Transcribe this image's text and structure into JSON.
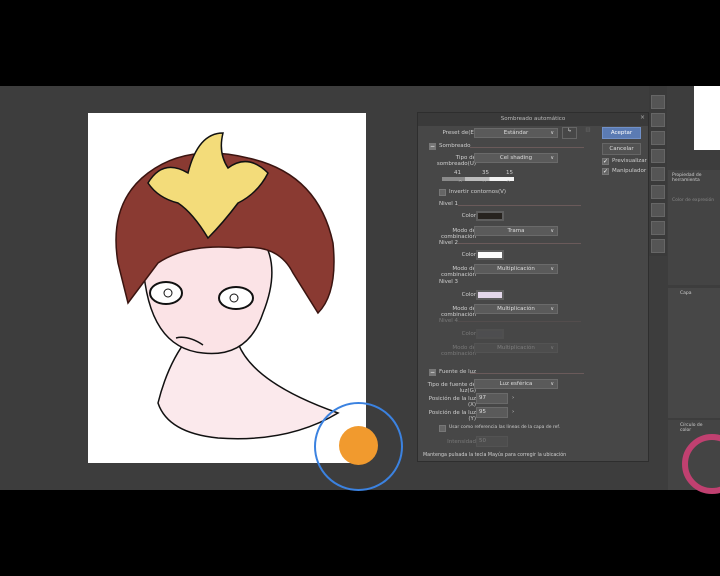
{
  "dialog": {
    "title": "Sombreado automático",
    "close": "×",
    "preset_label": "Preset de(E)",
    "preset_value": "Estándar",
    "ok": "Aceptar",
    "cancel": "Cancelar",
    "preview": "Previsualizar",
    "manipulator": "Manipulador",
    "shading_section": "Sombreado",
    "shading_type_label": "Tipo de sombreado(U)",
    "shading_type_value": "Cel shading",
    "slider_values": [
      "41",
      "35",
      "15"
    ],
    "invert_label": "Invertir contornos(V)",
    "levels": [
      {
        "title": "Nivel 1",
        "color_label": "Color",
        "color": "#27231f",
        "mode_label": "Modo de combinación",
        "mode": "Trama"
      },
      {
        "title": "Nivel 2",
        "color_label": "Color",
        "color": "#ffffff",
        "mode_label": "Modo de combinación",
        "mode": "Multiplicación"
      },
      {
        "title": "Nivel 3",
        "color_label": "Color",
        "color": "#e3d7ea",
        "mode_label": "Modo de combinación",
        "mode": "Multiplicación"
      },
      {
        "title": "Nivel 4",
        "color_label": "Color",
        "color": "#4e4e50",
        "mode_label": "Modo de combinación",
        "mode": "Multiplicación"
      }
    ],
    "light_section": "Fuente de luz",
    "light_type_label": "Tipo de fuente de luz(G)",
    "light_type_value": "Luz esférica",
    "pos_x_label": "Posición de la luz (X)",
    "pos_x": "97",
    "pos_y_label": "Posición de la luz (Y)",
    "pos_y": "95",
    "ref_label": "Usar como referencia las líneas de la capa de ref.",
    "intensity_label": "Intensidad",
    "intensity": "50",
    "footer": "Mantenga pulsada la tecla Mayús para corregir la ubicación"
  },
  "panels": {
    "property": "Propiedad de herramienta",
    "layer": "Capa",
    "color_wheel": "Círculo de color",
    "color_expr": "Color de expresión"
  }
}
